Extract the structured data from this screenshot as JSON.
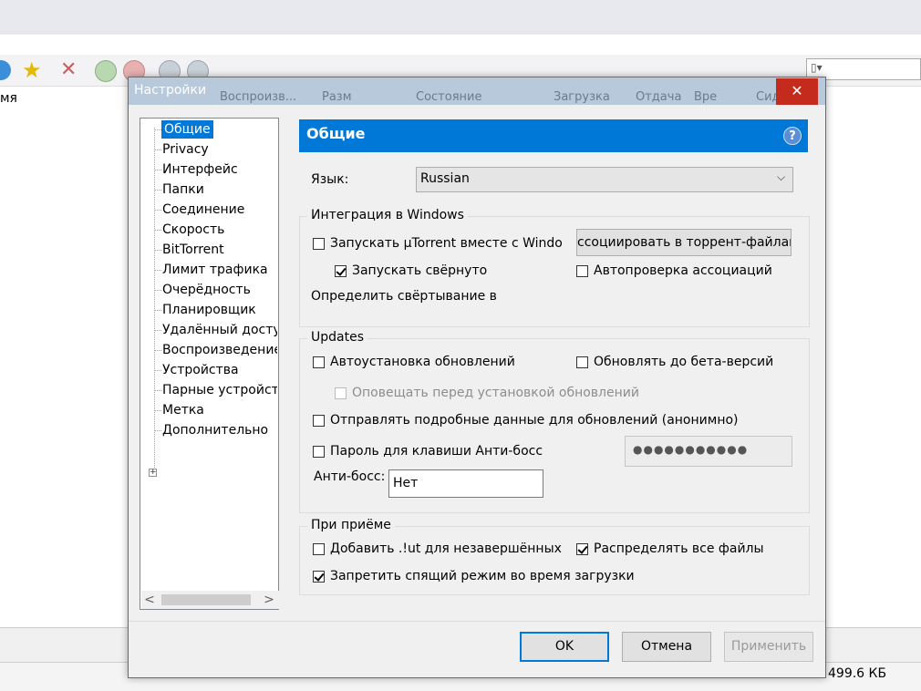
{
  "background_window": {
    "column_name_fragment": "мя",
    "status_size": "499.6 КБ"
  },
  "dialog": {
    "title": "Настройки",
    "ghost_headers": [
      "Воспроизв...",
      "Разм",
      "Состояние",
      "Загрузка",
      "Отдача",
      "Вре",
      "Сидь"
    ],
    "close_glyph": "✕"
  },
  "tree": {
    "items": [
      {
        "label": "Общие",
        "selected": true
      },
      {
        "label": "Privacy"
      },
      {
        "label": "Интерфейс"
      },
      {
        "label": "Папки"
      },
      {
        "label": "Соединение"
      },
      {
        "label": "Скорость"
      },
      {
        "label": "BitTorrent"
      },
      {
        "label": "Лимит трафика"
      },
      {
        "label": "Очерёдность"
      },
      {
        "label": "Планировщик"
      },
      {
        "label": "Удалённый доступ"
      },
      {
        "label": "Воспроизведение"
      },
      {
        "label": "Устройства"
      },
      {
        "label": "Парные устройства"
      },
      {
        "label": "Метка"
      },
      {
        "label": "Дополнительно",
        "expandable": true
      }
    ],
    "expand_glyph": "+",
    "scroll_left": "<",
    "scroll_right": ">"
  },
  "panel": {
    "title": "Общие",
    "help_glyph": "?",
    "language_label": "Язык:",
    "language_value": "Russian",
    "select_arrow": "⌵",
    "windows_group": {
      "title": "Интеграция в Windows",
      "start_with_windows": "Запускать µTorrent вместе с Windo",
      "start_minimized": "Запускать свёрнуто",
      "associate_button": "ссоциировать в торрент-файлам",
      "auto_check_assoc": "Автопроверка ассоциаций",
      "detect_minimize": "Определить свёртывание в"
    },
    "updates_group": {
      "title": "Updates",
      "auto_install": "Автоустановка обновлений",
      "beta_updates": "Обновлять до бета-версий",
      "notify_before": "Оповещать перед установкой обновлений",
      "send_details": "Отправлять подробные данные для обновлений (анонимно)",
      "boss_password": "Пароль для клавиши Анти-босс",
      "password_mask": "●●●●●●●●●●●",
      "boss_key_label": "Анти-босс:",
      "boss_key_value": "Нет"
    },
    "receive_group": {
      "title": "При приёме",
      "add_ut": "Добавить .!ut для незавершённых",
      "preallocate": "Распределять все файлы",
      "prevent_sleep": "Запретить спящий режим во время загрузки"
    }
  },
  "buttons": {
    "ok": "OK",
    "cancel": "Отмена",
    "apply": "Применить"
  },
  "checkbox_states": {
    "start_with_windows": false,
    "start_minimized": true,
    "auto_check_assoc": false,
    "auto_install": false,
    "beta_updates": false,
    "notify_before": false,
    "send_details": false,
    "boss_password": false,
    "add_ut": false,
    "preallocate": true,
    "prevent_sleep": true
  },
  "colors": {
    "accent": "#0078d7",
    "close_button": "#c42b1c"
  }
}
